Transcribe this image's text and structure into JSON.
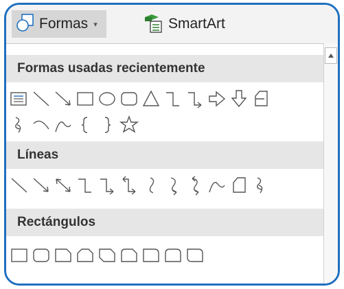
{
  "ribbon": {
    "shapes_button": {
      "label": "Formas",
      "icon": "shapes-icon",
      "caret": "▾"
    },
    "smartart_button": {
      "label": "SmartArt",
      "icon": "smartart-icon"
    }
  },
  "sections": [
    {
      "title": "Formas usadas recientemente",
      "rows": [
        [
          "text-box",
          "line",
          "arrow-line",
          "rectangle",
          "oval",
          "rounded-rectangle",
          "triangle",
          "elbow-connector",
          "elbow-arrow-connector",
          "right-arrow",
          "down-arrow",
          "flowchart-shape"
        ],
        [
          "freeform",
          "arc",
          "curve",
          "left-brace",
          "right-brace",
          "star"
        ]
      ]
    },
    {
      "title": "Líneas",
      "rows": [
        [
          "line",
          "arrow-line",
          "double-arrow-line",
          "elbow-connector",
          "elbow-arrow-connector",
          "elbow-double-arrow-connector",
          "curved-connector",
          "curved-arrow-connector",
          "curved-double-arrow-connector",
          "curve",
          "freeform-shape",
          "scribble"
        ]
      ]
    },
    {
      "title": "Rectángulos",
      "rows": [
        [
          "rectangle",
          "rounded-rectangle",
          "snip-single-corner-rectangle",
          "snip-same-side-corner-rectangle",
          "snip-diagonal-corner-rectangle",
          "snip-and-round-rectangle",
          "round-single-corner-rectangle",
          "round-same-side-rectangle",
          "round-diagonal-rectangle"
        ]
      ]
    }
  ],
  "scrollbar": {
    "up_icon": "scroll-up-icon"
  }
}
